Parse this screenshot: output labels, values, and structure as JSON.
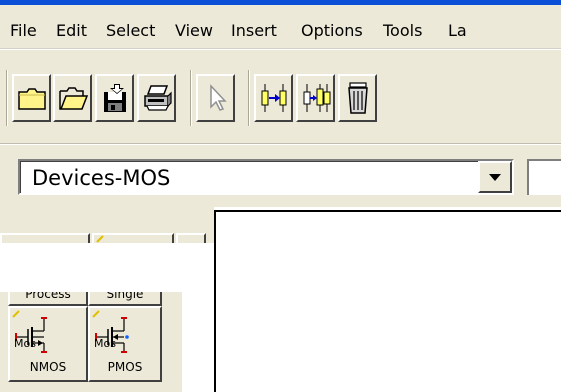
{
  "menu": [
    "File",
    "Edit",
    "Select",
    "View",
    "Insert",
    "Options",
    "Tools",
    "La"
  ],
  "toolbar": {
    "buttons": [
      {
        "name": "new-file-button",
        "icon": "new-folder-icon"
      },
      {
        "name": "open-file-button",
        "icon": "open-folder-icon"
      },
      {
        "name": "save-button",
        "icon": "floppy-save-icon"
      },
      {
        "name": "print-button",
        "icon": "printer-icon"
      },
      {
        "name": "select-pointer-button",
        "icon": "arrow-cursor-icon"
      },
      {
        "name": "connect-button",
        "icon": "connect-arrow-icon"
      },
      {
        "name": "connect-both-button",
        "icon": "connect-both-icon"
      },
      {
        "name": "delete-button",
        "icon": "trash-icon"
      }
    ]
  },
  "library": {
    "selected": "Devices-MOS"
  },
  "palette": {
    "tabs": [
      "Process",
      "Single"
    ],
    "items": [
      {
        "symbol": "Mos",
        "label": "NMOS"
      },
      {
        "symbol": "Mos",
        "label": "PMOS"
      }
    ]
  },
  "colors": {
    "chrome": "#ece9d8",
    "accent": "#0a4fd6",
    "pin_red": "#d00000"
  }
}
